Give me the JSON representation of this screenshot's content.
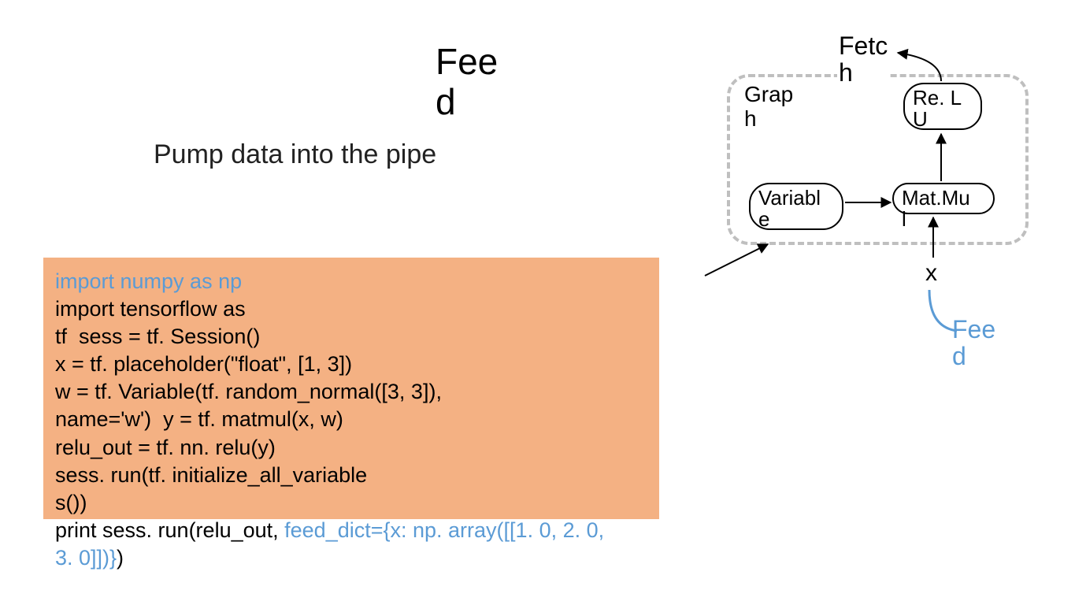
{
  "title": {
    "feed_line1": "Fee",
    "feed_line2": "d"
  },
  "subtitle": "Pump data into the pipe",
  "code": {
    "l1_blue": "import numpy as np",
    "l2": "import tensorflow as",
    "l3": "tf  sess = tf. Session()",
    "l4": "x = tf. placeholder(\"float\", [1, 3])",
    "l5": "w = tf. Variable(tf. random_normal([3, 3]),",
    "l6": "name='w')  y = tf. matmul(x, w)",
    "l7": "relu_out = tf. nn. relu(y)",
    "l8": "sess. run(tf. initialize_all_variable",
    "l9": "s())",
    "l10a": "print sess. run(relu_out, ",
    "l10b_blue": "feed_dict={x: np. array([[1. 0, 2. 0,",
    "l11_blue": "3. 0]])}",
    "l11_end": ")"
  },
  "diagram": {
    "fetch": "Fetc\nh",
    "graph": "Grap\nh",
    "variable": "Variabl\ne",
    "matmul": "Mat.Mu\nl",
    "relu": "Re. L\nU",
    "x": "x",
    "feed_callout": "Fee\nd"
  }
}
